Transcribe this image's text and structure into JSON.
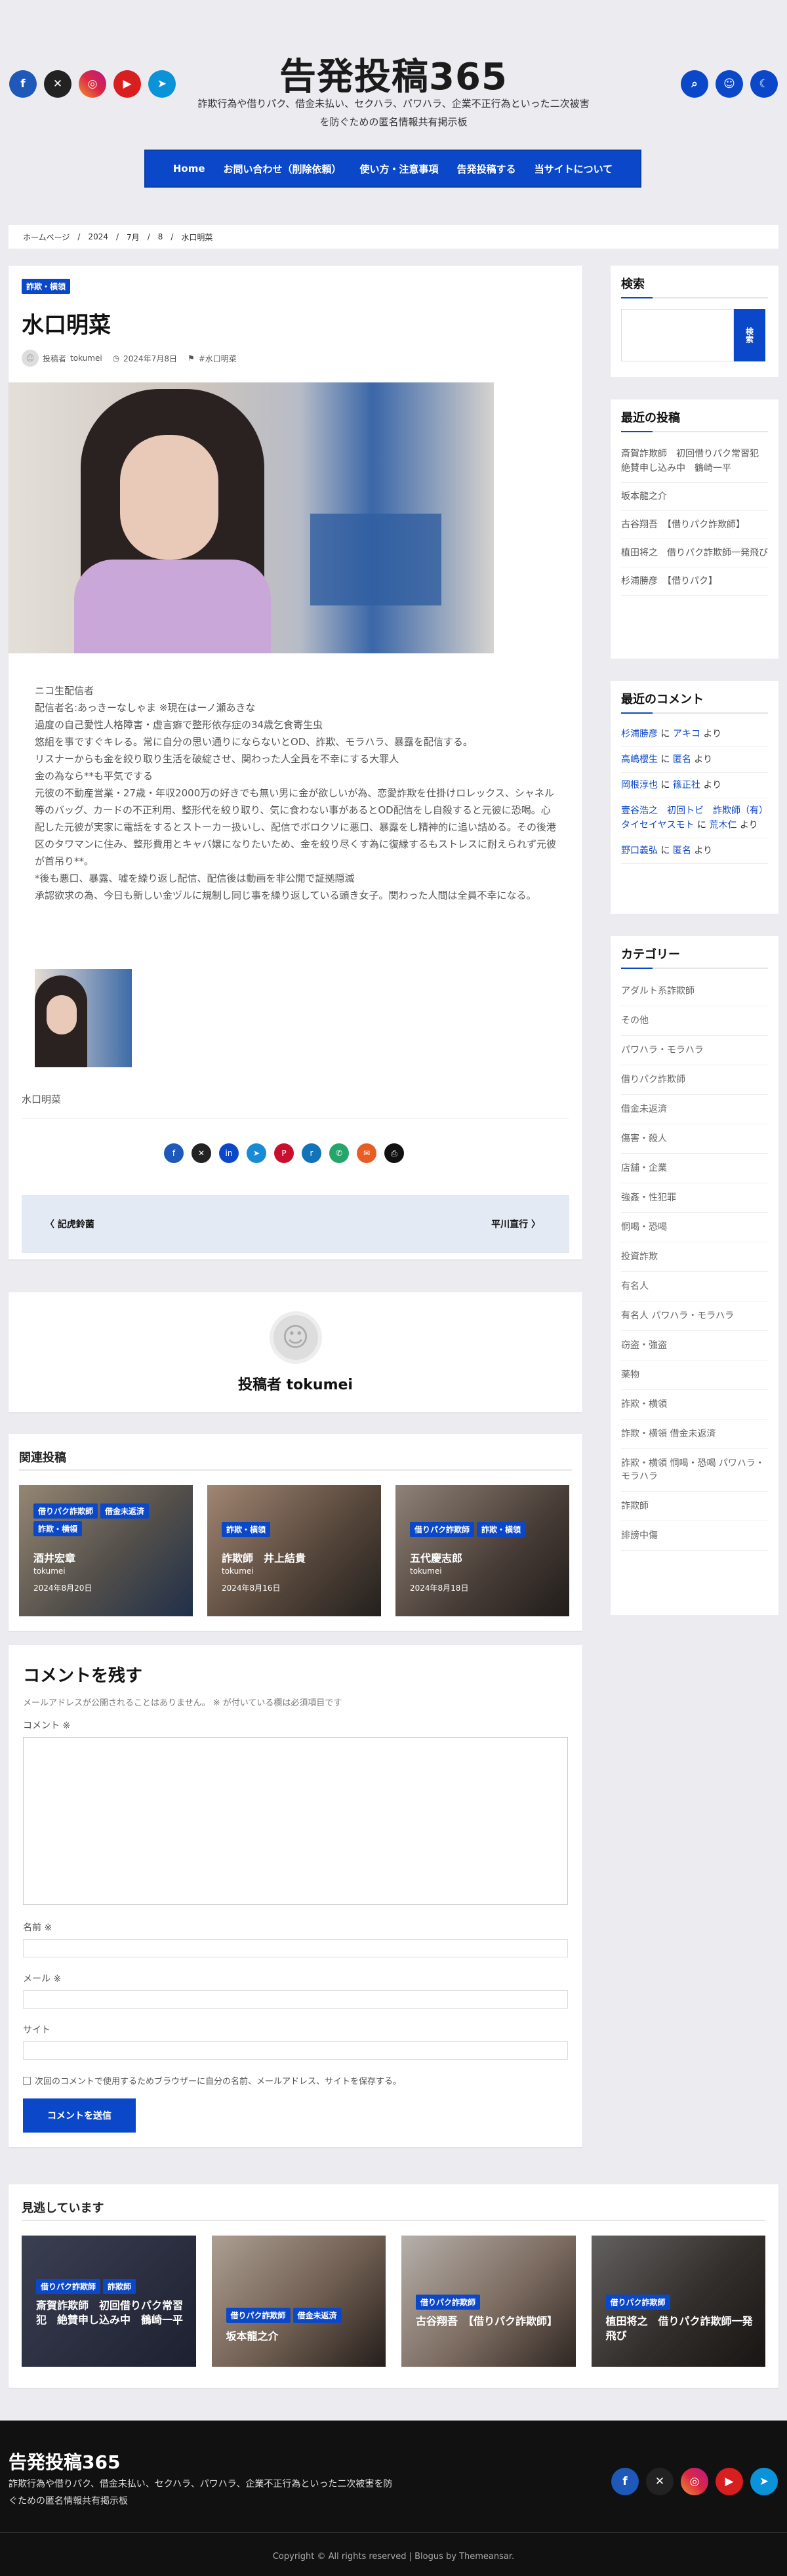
{
  "site": {
    "title": "告発投稿365",
    "desc": "詐欺行為や借りパク、借金未払い、セクハラ、パワハラ、企業不正行為といった二次被害を防ぐための匿名情報共有掲示板"
  },
  "nav": [
    "Home",
    "お問い合わせ（削除依頼）",
    "使い方・注意事項",
    "告発投稿する",
    "当サイトについて"
  ],
  "breadcrumb": [
    "ホームページ",
    "2024",
    "7月",
    "8",
    "水口明菜"
  ],
  "post": {
    "category": "詐欺・横領",
    "title": "水口明菜",
    "author_prefix": "投稿者",
    "author": "tokumei",
    "date": "2024年7月8日",
    "tag": "#水口明菜",
    "body": [
      "ニコ生配信者",
      "配信者名:あっきーなしゃま ※現在はーノ瀬あきな",
      "過度の自己愛性人格障害・虚言癖で整形依存症の34歳乞食寄生虫",
      "悠組を事ですぐキレる。常に自分の思い通りにならないとOD、詐欺、モラハラ、暴露を配信する。",
      "リスナーからも金を絞り取り生活を破綻させ、関わった人全員を不幸にする大罪人",
      "金の為なら**も平気でする",
      "元彼の不動産営業・27歳・年収2000万の好きでも無い男に金が欲しいが為、恋愛詐欺を仕掛けロレックス、シャネル等のバッグ、カードの不正利用、整形代を絞り取り、気に食わない事があるとOD配信をし自殺すると元彼に恐喝。心配した元彼が実家に電話をするとストーカー扱いし、配信でボロクソに悪口、暴露をし精神的に追い詰める。その後港区のタワマンに住み、整形費用とキャバ嬢になりたいため、金を絞り尽くす為に復縁するもストレスに耐えられず元彼が首吊り**。",
      "*後も悪口、暴露、嘘を繰り返し配信、配信後は動画を非公開で証拠隠滅",
      "承認欲求の為、今日も新しい金ヅルに規制し同じ事を繰り返している頭き女子。関わった人間は全員不幸になる。"
    ],
    "caption": "水口明菜"
  },
  "postnav": {
    "prev": "記虎鈴菌",
    "next": "平川直行"
  },
  "author_box": {
    "label": "投稿者 tokumei"
  },
  "related": {
    "heading": "関連投稿",
    "items": [
      {
        "tags": [
          "借りパク詐欺師",
          "借金未返済",
          "詐欺・横領"
        ],
        "title": "酒井宏章",
        "author": "tokumei",
        "date": "2024年8月20日"
      },
      {
        "tags": [
          "詐欺・横領"
        ],
        "title": "詐欺師　井上結貴",
        "author": "tokumei",
        "date": "2024年8月16日"
      },
      {
        "tags": [
          "借りパク詐欺師",
          "詐欺・横領"
        ],
        "title": "五代慶志郎",
        "author": "tokumei",
        "date": "2024年8月18日"
      }
    ]
  },
  "comment": {
    "heading": "コメントを残す",
    "note": "メールアドレスが公開されることはありません。 ※ が付いている欄は必須項目です",
    "comment_label": "コメント ※",
    "name_label": "名前 ※",
    "email_label": "メール ※",
    "site_label": "サイト",
    "save_label": "次回のコメントで使用するためブラウザーに自分の名前、メールアドレス、サイトを保存する。",
    "submit": "コメントを送信"
  },
  "missed": {
    "heading": "見逃しています",
    "items": [
      {
        "tags": [
          "借りパク詐欺師",
          "詐欺師"
        ],
        "title": "斎賀詐欺師　初回借りパク常習犯　絶賛申し込み中　鶴崎一平"
      },
      {
        "tags": [
          "借りパク詐欺師",
          "借金未返済"
        ],
        "title": "坂本龍之介"
      },
      {
        "tags": [
          "借りパク詐欺師"
        ],
        "title": "古谷翔吾　【借りパク詐欺師】"
      },
      {
        "tags": [
          "借りパク詐欺師"
        ],
        "title": "植田将之　借りパク詐欺師一発飛び"
      }
    ]
  },
  "sidebar": {
    "search_title": "検索",
    "search_button": "検索",
    "recent_title": "最近の投稿",
    "recent": [
      "斎賀詐欺師　初回借りパク常習犯　絶賛申し込み中　鶴崎一平",
      "坂本龍之介",
      "古谷翔吾　【借りパク詐欺師】",
      "植田将之　借りパク詐欺師一発飛び",
      "杉浦勝彦　【借りパク】"
    ],
    "comments_title": "最近のコメント",
    "comments": [
      {
        "author": "杉浦勝彦",
        "mid": " に ",
        "post": "アキコ",
        "end": " より"
      },
      {
        "author": "高嶋櫻生",
        "mid": " に ",
        "post": "匿名",
        "end": " より"
      },
      {
        "author": "岡根淳也",
        "mid": " に ",
        "post": "篠正社",
        "end": " より"
      },
      {
        "author": "壹谷浩之　初回トビ　詐欺師（有）タイセイヤスモト",
        "mid": " に ",
        "post": "荒木仁",
        "end": " より"
      },
      {
        "author": "野口義弘",
        "mid": " に ",
        "post": "匿名",
        "end": " より"
      }
    ],
    "categories_title": "カテゴリー",
    "categories": [
      "アダルト系詐欺師",
      "その他",
      "パワハラ・モラハラ",
      "借りパク詐欺師",
      "借金未返済",
      "傷害・殺人",
      "店舗・企業",
      "強姦・性犯罪",
      "恫喝・恐喝",
      "投資詐欺",
      "有名人",
      "有名人 パワハラ・モラハラ",
      "窃盗・強盗",
      "薬物",
      "詐欺・横領",
      "詐欺・横領 借金未返済",
      "詐欺・横領 恫喝・恐喝 パワハラ・モラハラ",
      "詐欺師",
      "誹謗中傷"
    ]
  },
  "footer": {
    "title": "告発投稿365",
    "desc": "詐欺行為や借りパク、借金未払い、セクハラ、パワハラ、企業不正行為といった二次被害を防ぐための匿名情報共有掲示板",
    "copyright": "Copyright © All rights reserved | Blogus by Themeansar."
  }
}
